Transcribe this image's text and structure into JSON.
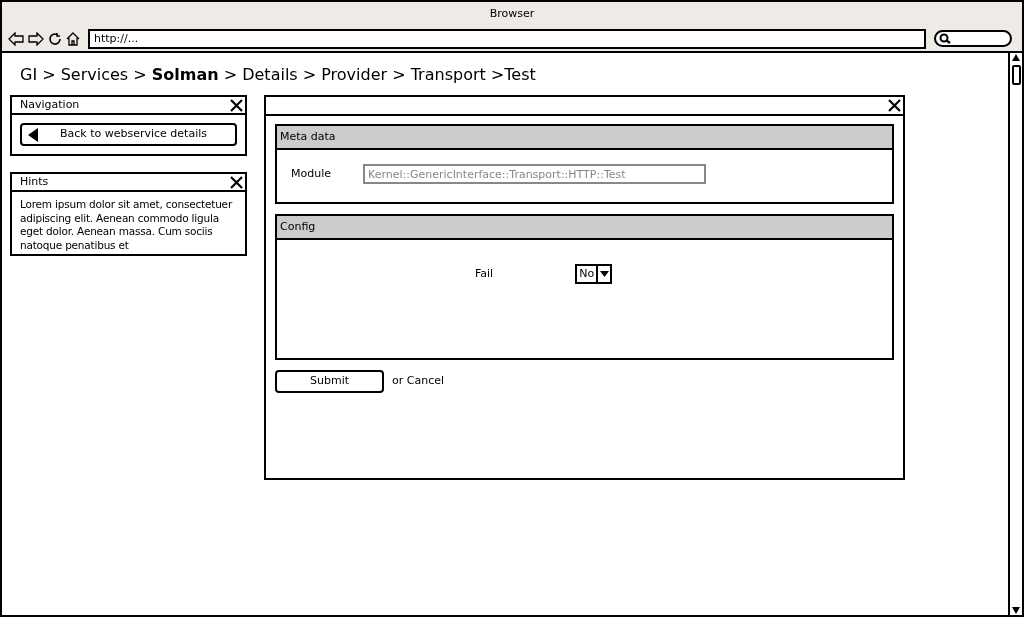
{
  "window": {
    "title": "Browser"
  },
  "address_bar": {
    "value": "http://..."
  },
  "breadcrumb": "GI > Services > **Solman** > Details > Provider > Transport >Test",
  "navigation_panel": {
    "title": "Navigation",
    "button": "Back to webservice details"
  },
  "hints_panel": {
    "title": "Hints",
    "text": "Lorem ipsum dolor sit amet, consectetuer adipiscing elit. Aenean commodo ligula eget dolor. Aenean massa. Cum sociis natoque penatibus et"
  },
  "sections": [
    {
      "title": "Meta data",
      "fields": [
        {
          "kind": "text",
          "label": "Module",
          "placeholder": "Kernel::GenericInterface::Transport::HTTP::Test"
        }
      ]
    },
    {
      "title": "Config",
      "fields": [
        {
          "kind": "select",
          "label": "Fail",
          "value": "No"
        }
      ]
    }
  ],
  "actions": {
    "submit": "Submit",
    "cancel": "or Cancel"
  }
}
